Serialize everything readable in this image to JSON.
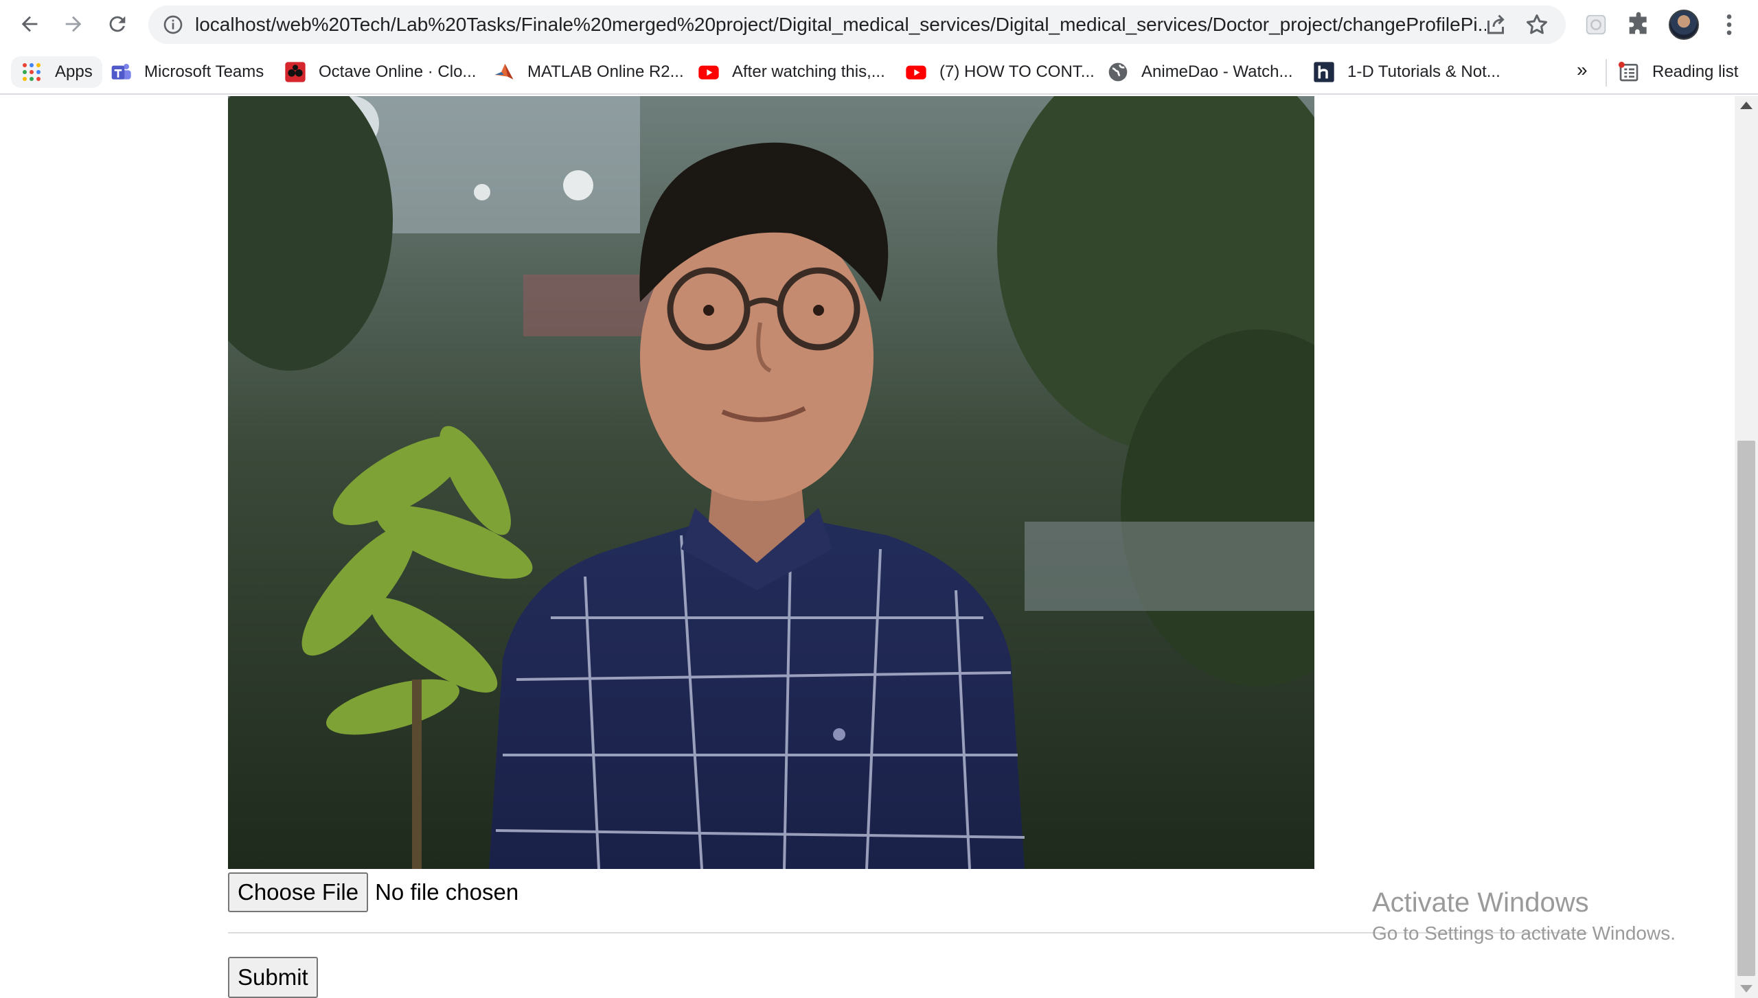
{
  "browser": {
    "url": "localhost/web%20Tech/Lab%20Tasks/Finale%20merged%20project/Digital_medical_services/Digital_medical_services/Doctor_project/changeProfilePi...",
    "back_icon": "arrow-left-icon",
    "forward_icon": "arrow-right-icon",
    "reload_icon": "reload-icon"
  },
  "bookmarks": {
    "items": [
      {
        "label": "Apps",
        "icon": "apps-grid-icon"
      },
      {
        "label": "Microsoft Teams",
        "icon": "teams-icon"
      },
      {
        "label": "Octave Online · Clo...",
        "icon": "octave-icon"
      },
      {
        "label": "MATLAB Online R2...",
        "icon": "matlab-icon"
      },
      {
        "label": "After watching this,...",
        "icon": "youtube-icon"
      },
      {
        "label": "(7) HOW TO CONT...",
        "icon": "youtube-icon"
      },
      {
        "label": "AnimeDao - Watch...",
        "icon": "globe-icon"
      },
      {
        "label": "1-D Tutorials & Not...",
        "icon": "h-icon"
      }
    ],
    "overflow": "»",
    "reading_list": "Reading list"
  },
  "form": {
    "choose_file_label": "Choose File",
    "file_status": "No file chosen",
    "submit_label": "Submit"
  },
  "watermark": {
    "title": "Activate Windows",
    "subtitle": "Go to Settings to activate Windows."
  },
  "colors": {
    "youtube_red": "#ff0000",
    "teams_purple": "#5059c9",
    "octave_red": "#d4262c",
    "matlab_orange": "#e16737"
  }
}
